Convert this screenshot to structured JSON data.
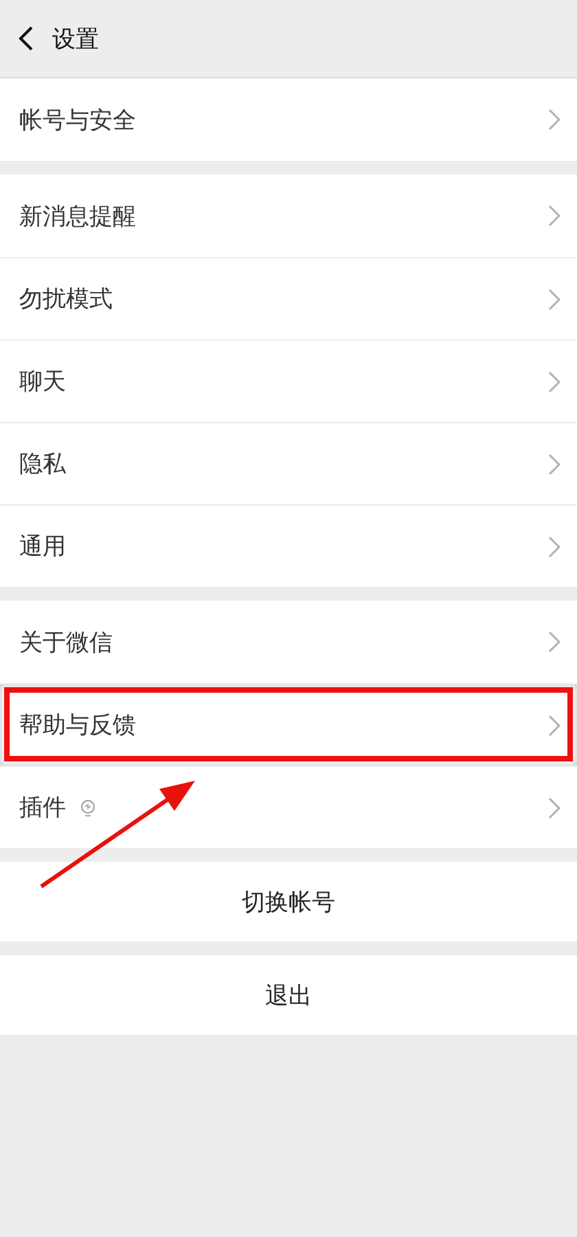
{
  "header": {
    "title": "设置"
  },
  "groups": [
    {
      "items": [
        {
          "label": "帐号与安全",
          "kind": "plain",
          "highlighted": false
        }
      ]
    },
    {
      "items": [
        {
          "label": "新消息提醒",
          "kind": "plain",
          "highlighted": false
        },
        {
          "label": "勿扰模式",
          "kind": "plain",
          "highlighted": false
        },
        {
          "label": "聊天",
          "kind": "plain",
          "highlighted": false
        },
        {
          "label": "隐私",
          "kind": "plain",
          "highlighted": false
        },
        {
          "label": "通用",
          "kind": "plain",
          "highlighted": false
        }
      ]
    },
    {
      "items": [
        {
          "label": "关于微信",
          "kind": "plain",
          "highlighted": false
        },
        {
          "label": "帮助与反馈",
          "kind": "plain",
          "highlighted": true
        },
        {
          "label": "插件",
          "kind": "with-icon",
          "highlighted": false
        }
      ]
    }
  ],
  "actions": [
    "切换帐号",
    "退出"
  ]
}
